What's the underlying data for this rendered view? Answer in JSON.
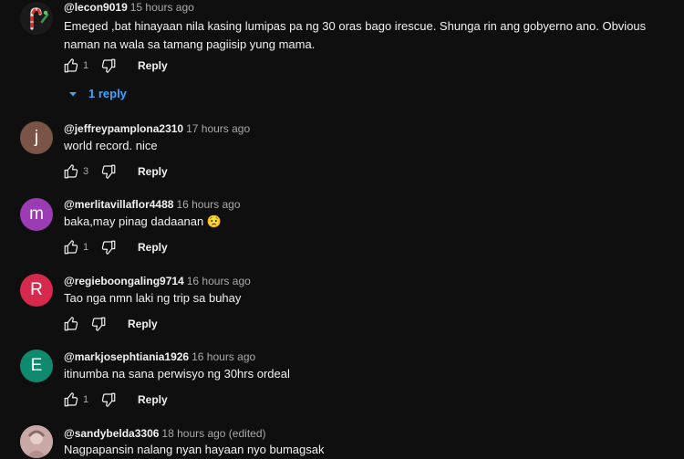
{
  "comments": [
    {
      "handle": "@lecon9019",
      "time": "15 hours ago",
      "text": "Emeged ,bat hinayaan nila kasing lumipas pa ng 30 oras bago irescue.  Shunga rin ang gobyerno ano. Obvious naman na wala sa tamang pagiisip yung mama.",
      "likes": "1",
      "reply_label": "Reply",
      "replies_label": "1 reply",
      "avatar_color": "#1c1c1c"
    },
    {
      "handle": "@jeffreypamplona2310",
      "time": "17 hours ago",
      "text": "world record. nice",
      "likes": "3",
      "reply_label": "Reply",
      "avatar_letter": "j",
      "avatar_color": "#7a5547"
    },
    {
      "handle": "@merlitavillaflor4488",
      "time": "16 hours ago",
      "text": "baka,may pinag dadaanan 😟",
      "likes": "1",
      "reply_label": "Reply",
      "avatar_letter": "m",
      "avatar_color": "#9c3cb4"
    },
    {
      "handle": "@regieboongaling9714",
      "time": "16 hours ago",
      "text": "Tao nga nmn laki ng trip sa buhay",
      "likes": "",
      "reply_label": "Reply",
      "avatar_letter": "R",
      "avatar_color": "#d6294d"
    },
    {
      "handle": "@markjosephtiania1926",
      "time": "16 hours ago",
      "text": "itinumba na sana perwisyo ng 30hrs ordeal",
      "likes": "1",
      "reply_label": "Reply",
      "avatar_letter": "E",
      "avatar_color": "#0f8a6e"
    },
    {
      "handle": "@sandybelda3306",
      "time": "18 hours ago (edited)",
      "text": "Nagpapansin nalang nyan hayaan nyo bumagsak",
      "avatar_color": "#c9a9a6"
    }
  ],
  "icons": {
    "like": "thumbs-up-icon",
    "dislike": "thumbs-down-icon",
    "expand": "chevron-down-icon"
  },
  "colors": {
    "background": "#0f0f0f",
    "text": "#f1f1f1",
    "secondary": "#aaaaaa",
    "link": "#3ea6ff"
  }
}
